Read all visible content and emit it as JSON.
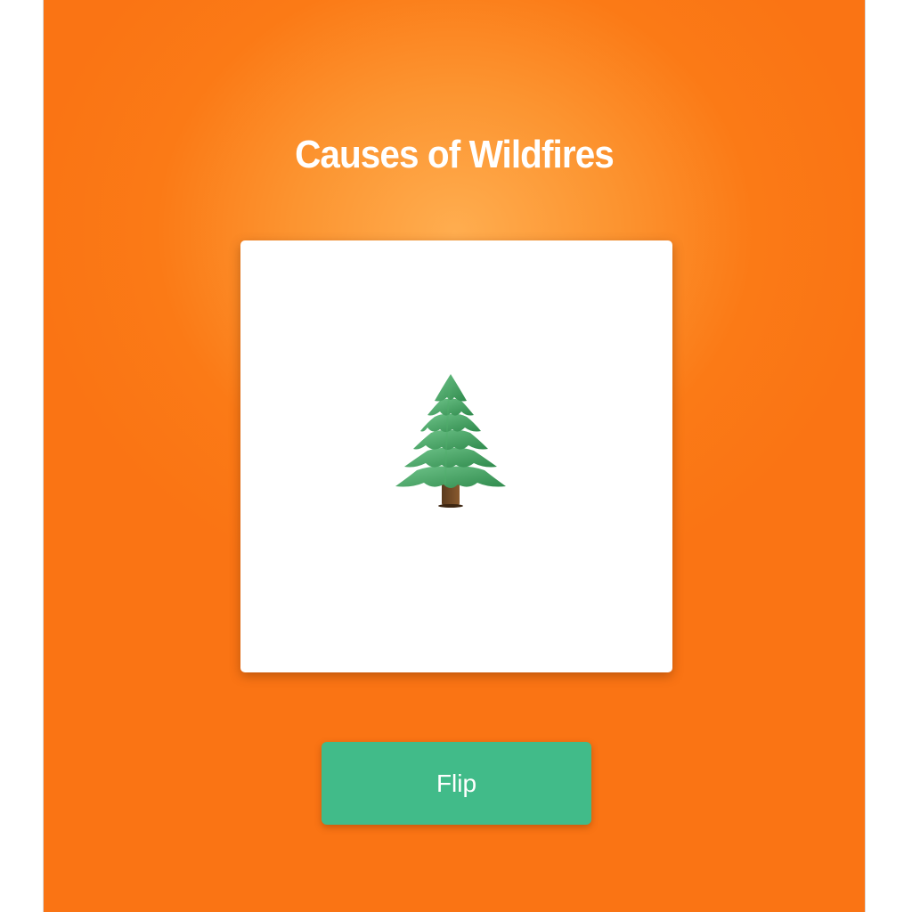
{
  "page": {
    "title": "Causes of Wildfires"
  },
  "card": {
    "icon": "evergreen-tree-icon"
  },
  "actions": {
    "flip_label": "Flip"
  },
  "colors": {
    "background_center": "#ffad4f",
    "background_edge": "#fa7414",
    "card_background": "#ffffff",
    "button_background": "#41bb89",
    "text": "#ffffff"
  }
}
